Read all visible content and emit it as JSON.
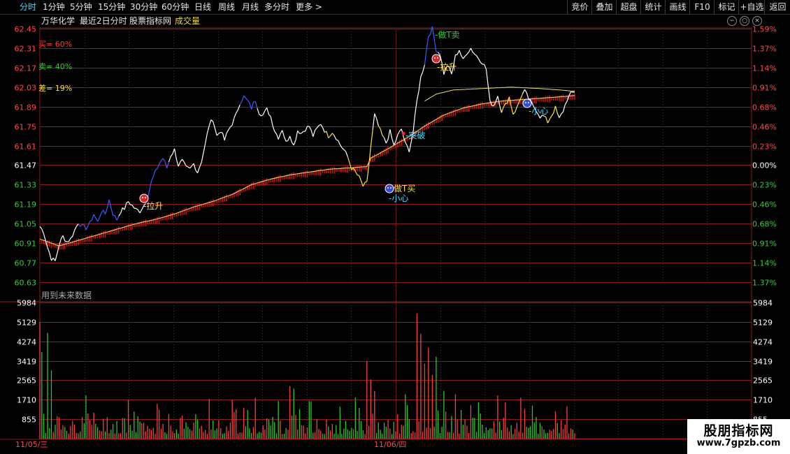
{
  "toolbar": {
    "left_items": [
      "分时",
      "1分钟",
      "5分钟",
      "15分钟",
      "30分钟",
      "60分钟",
      "日线",
      "周线",
      "月线",
      "多分时",
      "更多 >"
    ],
    "active_index": 0,
    "right_items": [
      "竞价",
      "叠加",
      "超盘",
      "统计",
      "画线",
      "F10",
      "标记",
      "+自选",
      "返回"
    ]
  },
  "titlebar": {
    "stock_name": "万华化学",
    "period": "最近2日分时",
    "indicator": "股票指标网",
    "volume_label": "成交量"
  },
  "overlay_labels": {
    "sell_pct": "买= 60%",
    "buy_pct": "卖= 40%",
    "diff_pct": "差= 19%",
    "future_data": "用到未来数据"
  },
  "annotations": {
    "do_t_sell": "-做T卖",
    "pull_up_1": "-拉升",
    "pull_up_2": "-拉升",
    "do_t_buy": "做T买",
    "careful_1": "-小心",
    "careful_2": "-小心",
    "breakout": "-突破"
  },
  "colors": {
    "background": "#000000",
    "grid": "#8b1a1a",
    "price_line": "#ffffff",
    "avg_line": "#e8e070",
    "up": "#ff3c3c",
    "down": "#26c826",
    "blue_segment": "#3a5cff",
    "yellow_segment": "#ffe23a",
    "axis_text_up": "#ff4a4a",
    "axis_text_down": "#2fd12f",
    "axis_text_neutral": "#ffffff",
    "active_tab": "#49d7ff"
  },
  "watermark": {
    "line1": "股朋指标网",
    "line2": "www.7gpzb.com"
  },
  "chart_data": {
    "type": "line",
    "title": "万华化学 最近2日分时",
    "price_axis": {
      "ticks": [
        62.45,
        62.31,
        62.17,
        62.03,
        61.89,
        61.75,
        61.61,
        61.47,
        61.33,
        61.19,
        61.05,
        60.91,
        60.77,
        60.63
      ],
      "labels": [
        "62.45",
        "62.31",
        "62.17",
        "62.03",
        "61.89",
        "61.75",
        "61.61",
        "61.47",
        "61.33",
        "61.19",
        "61.05",
        "60.91",
        "60.77",
        "60.63"
      ],
      "reference": 61.47,
      "range": [
        60.63,
        62.45
      ]
    },
    "pct_axis": {
      "labels": [
        "1.59%",
        "1.37%",
        "1.14%",
        "0.91%",
        "0.68%",
        "0.46%",
        "0.23%",
        "0.00%",
        "0.23%",
        "0.46%",
        "0.68%",
        "0.91%",
        "1.14%",
        "1.37%"
      ]
    },
    "volume_axis": {
      "labels": [
        "5984",
        "5129",
        "4274",
        "3419",
        "2565",
        "1710",
        "855"
      ],
      "range": [
        0,
        5984
      ]
    },
    "x_labels": [
      "11/05/三",
      "11/06/四"
    ],
    "price_keypoints": [
      [
        0,
        61.03
      ],
      [
        2,
        60.99
      ],
      [
        4,
        60.88
      ],
      [
        6,
        60.8
      ],
      [
        8,
        60.78
      ],
      [
        10,
        60.9
      ],
      [
        12,
        60.96
      ],
      [
        14,
        60.92
      ],
      [
        16,
        60.94
      ],
      [
        18,
        61.0
      ],
      [
        20,
        61.06
      ],
      [
        22,
        61.03
      ],
      [
        24,
        61.02
      ],
      [
        26,
        61.05
      ],
      [
        28,
        61.12
      ],
      [
        30,
        61.06
      ],
      [
        32,
        61.14
      ],
      [
        34,
        61.12
      ],
      [
        36,
        61.22
      ],
      [
        38,
        61.12
      ],
      [
        40,
        61.08
      ],
      [
        42,
        61.14
      ],
      [
        44,
        61.16
      ],
      [
        46,
        61.21
      ],
      [
        48,
        61.18
      ],
      [
        50,
        61.15
      ],
      [
        52,
        61.14
      ],
      [
        54,
        61.18
      ],
      [
        56,
        61.24
      ],
      [
        58,
        61.35
      ],
      [
        60,
        61.42
      ],
      [
        62,
        61.48
      ],
      [
        64,
        61.52
      ],
      [
        66,
        61.45
      ],
      [
        68,
        61.54
      ],
      [
        70,
        61.58
      ],
      [
        72,
        61.47
      ],
      [
        74,
        61.5
      ],
      [
        76,
        61.45
      ],
      [
        78,
        61.44
      ],
      [
        80,
        61.48
      ],
      [
        82,
        61.42
      ],
      [
        84,
        61.5
      ],
      [
        86,
        61.62
      ],
      [
        88,
        61.76
      ],
      [
        90,
        61.8
      ],
      [
        92,
        61.68
      ],
      [
        94,
        61.72
      ],
      [
        96,
        61.65
      ],
      [
        98,
        61.72
      ],
      [
        100,
        61.77
      ],
      [
        102,
        61.83
      ],
      [
        104,
        61.92
      ],
      [
        106,
        61.96
      ],
      [
        108,
        61.93
      ],
      [
        110,
        61.88
      ],
      [
        112,
        61.94
      ],
      [
        114,
        61.85
      ],
      [
        116,
        61.83
      ],
      [
        118,
        61.87
      ],
      [
        120,
        61.82
      ],
      [
        122,
        61.72
      ],
      [
        124,
        61.67
      ],
      [
        126,
        61.73
      ],
      [
        128,
        61.63
      ],
      [
        130,
        61.69
      ],
      [
        132,
        61.61
      ],
      [
        134,
        61.72
      ],
      [
        136,
        61.7
      ],
      [
        138,
        61.73
      ],
      [
        140,
        61.75
      ],
      [
        142,
        61.68
      ],
      [
        144,
        61.73
      ],
      [
        146,
        61.77
      ],
      [
        148,
        61.72
      ],
      [
        150,
        61.68
      ],
      [
        152,
        61.71
      ],
      [
        154,
        61.67
      ],
      [
        156,
        61.62
      ],
      [
        158,
        61.58
      ],
      [
        160,
        61.53
      ],
      [
        162,
        61.45
      ],
      [
        164,
        61.42
      ],
      [
        166,
        61.38
      ],
      [
        168,
        61.32
      ],
      [
        170,
        61.34
      ],
      [
        172,
        61.6
      ],
      [
        174,
        61.83
      ],
      [
        176,
        61.75
      ],
      [
        178,
        61.68
      ],
      [
        180,
        61.63
      ],
      [
        182,
        61.71
      ],
      [
        184,
        61.61
      ],
      [
        186,
        61.68
      ],
      [
        188,
        61.73
      ],
      [
        190,
        61.62
      ],
      [
        192,
        61.58
      ],
      [
        194,
        61.7
      ],
      [
        196,
        61.93
      ],
      [
        198,
        62.1
      ],
      [
        200,
        62.2
      ],
      [
        202,
        62.4
      ],
      [
        204,
        62.45
      ],
      [
        206,
        62.3
      ],
      [
        208,
        62.27
      ],
      [
        210,
        62.13
      ],
      [
        212,
        62.19
      ],
      [
        214,
        62.12
      ],
      [
        216,
        62.25
      ],
      [
        218,
        62.3
      ],
      [
        220,
        62.22
      ],
      [
        222,
        62.28
      ],
      [
        224,
        62.31
      ],
      [
        226,
        62.27
      ],
      [
        228,
        62.24
      ],
      [
        230,
        62.21
      ],
      [
        232,
        62.16
      ],
      [
        234,
        61.92
      ],
      [
        236,
        61.9
      ],
      [
        238,
        61.97
      ],
      [
        240,
        61.86
      ],
      [
        242,
        61.9
      ],
      [
        244,
        61.96
      ],
      [
        246,
        61.84
      ],
      [
        248,
        61.88
      ],
      [
        250,
        61.96
      ],
      [
        252,
        62.0
      ],
      [
        254,
        61.95
      ],
      [
        256,
        61.9
      ],
      [
        258,
        61.87
      ],
      [
        260,
        61.82
      ],
      [
        262,
        61.82
      ],
      [
        264,
        61.78
      ],
      [
        266,
        61.83
      ],
      [
        268,
        61.88
      ],
      [
        270,
        61.8
      ],
      [
        272,
        61.86
      ],
      [
        274,
        61.94
      ],
      [
        276,
        61.98
      ],
      [
        278,
        62.0
      ]
    ],
    "avg_keypoints": [
      [
        0,
        60.94
      ],
      [
        10,
        60.89
      ],
      [
        20,
        60.93
      ],
      [
        30,
        60.97
      ],
      [
        40,
        61.01
      ],
      [
        50,
        61.05
      ],
      [
        60,
        61.08
      ],
      [
        70,
        61.12
      ],
      [
        80,
        61.17
      ],
      [
        90,
        61.21
      ],
      [
        100,
        61.26
      ],
      [
        110,
        61.33
      ],
      [
        120,
        61.37
      ],
      [
        130,
        61.4
      ],
      [
        140,
        61.42
      ],
      [
        150,
        61.44
      ],
      [
        160,
        61.45
      ],
      [
        170,
        61.46
      ],
      [
        172,
        61.52
      ],
      [
        180,
        61.58
      ],
      [
        190,
        61.66
      ],
      [
        200,
        61.75
      ],
      [
        210,
        61.83
      ],
      [
        220,
        61.88
      ],
      [
        230,
        61.91
      ],
      [
        240,
        61.93
      ],
      [
        250,
        61.94
      ],
      [
        260,
        61.95
      ],
      [
        270,
        61.96
      ],
      [
        278,
        61.97
      ]
    ],
    "slow_line_keypoints": [
      [
        200,
        61.93
      ],
      [
        206,
        61.98
      ],
      [
        215,
        62.01
      ],
      [
        230,
        62.02
      ],
      [
        245,
        62.03
      ],
      [
        260,
        62.02
      ],
      [
        270,
        62.01
      ],
      [
        278,
        62.0
      ]
    ],
    "volume_seed": 11,
    "volume_spikes": [
      [
        0,
        5129
      ],
      [
        1,
        3800
      ],
      [
        4,
        4650
      ],
      [
        6,
        3000
      ],
      [
        24,
        1900
      ],
      [
        46,
        1700
      ],
      [
        88,
        1750
      ],
      [
        100,
        1700
      ],
      [
        112,
        1800
      ],
      [
        124,
        1650
      ],
      [
        130,
        2300
      ],
      [
        132,
        2200
      ],
      [
        140,
        1650
      ],
      [
        156,
        1400
      ],
      [
        164,
        1800
      ],
      [
        166,
        1350
      ],
      [
        170,
        3400
      ],
      [
        172,
        2600
      ],
      [
        174,
        2100
      ],
      [
        190,
        1950
      ],
      [
        196,
        5500
      ],
      [
        198,
        4600
      ],
      [
        200,
        3300
      ],
      [
        202,
        4000
      ],
      [
        204,
        2800
      ],
      [
        206,
        3600
      ],
      [
        210,
        2100
      ],
      [
        216,
        1950
      ],
      [
        228,
        1600
      ],
      [
        238,
        1900
      ],
      [
        242,
        1600
      ],
      [
        250,
        1800
      ],
      [
        256,
        1450
      ],
      [
        268,
        1200
      ]
    ]
  }
}
